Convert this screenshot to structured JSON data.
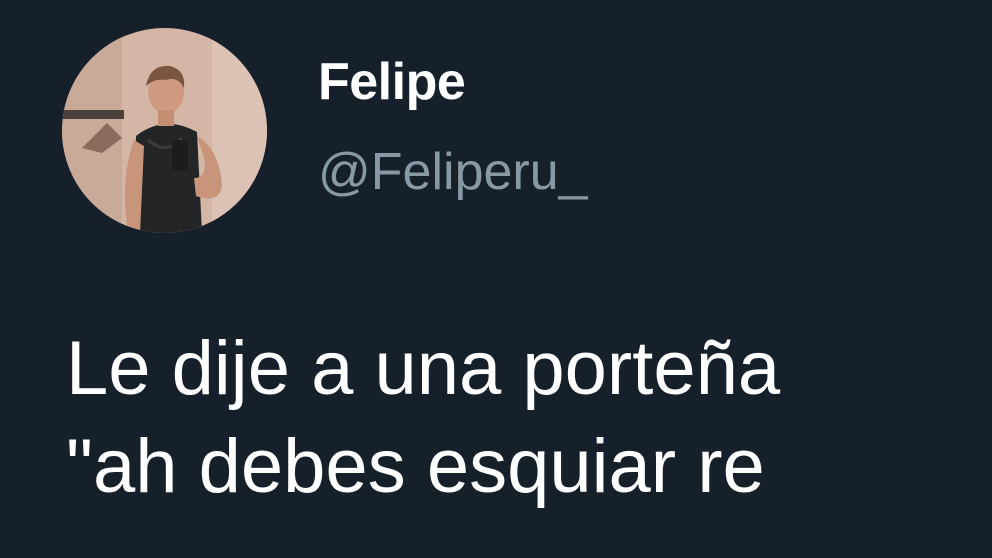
{
  "tweet": {
    "author": {
      "display_name": "Felipe",
      "handle": "@Feliperu_",
      "avatar_icon": "profile-photo"
    },
    "text_lines": [
      "Le dije a una porteña",
      "\"ah debes esquiar re"
    ]
  },
  "colors": {
    "background": "#16202b",
    "primary_text": "#ffffff",
    "secondary_text": "#8899a6"
  }
}
